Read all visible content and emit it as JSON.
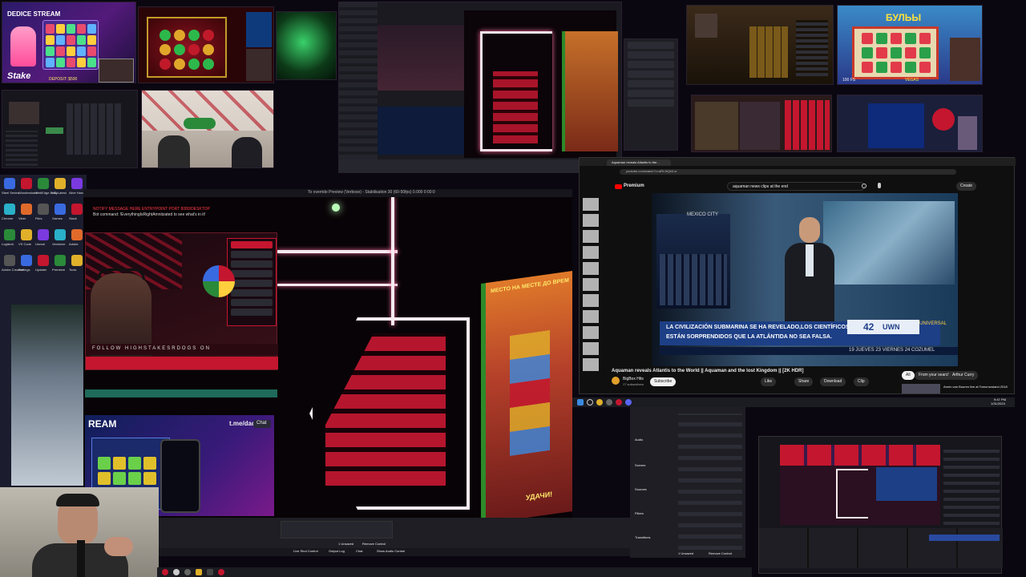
{
  "top_left_stream": {
    "title": "DEDICE STREAM",
    "brand": "Stake",
    "deposit_label": "DEPOSIT: $500"
  },
  "main_window": {
    "title": "To override Preview (Verbose) - Stabilisation 30 (60-50fps) 0.000 0:00:0",
    "chat_lines": [
      "NOTIFY MESSAGE HERE ENTRYPOINT PORT 8080/DESKTOP",
      "Bot command: !EverythingIsRightAmnitzated to see what's in it!"
    ],
    "follow_banner": "FOLLOW HIGHSTAKESRDOGS ON",
    "stream_label": "REAM",
    "telegram_label": "t.me/dad",
    "chat_button": "Chat",
    "slot_banner_top": "МЕСТО НА МЕСТЕ ДО ВРЕМ",
    "slot_banner_bottom": "УДАЧИ!",
    "status_items": [
      "1 Unsaved",
      "Remove Control"
    ],
    "bottom_tabs": [
      "Live Shot Control",
      "Output Log",
      "Chat",
      "Show Audio Control"
    ]
  },
  "obs_side_panel": {
    "section_labels": [
      "Audio",
      "Scenes",
      "Sources",
      "Filters",
      "Transitions"
    ],
    "bottom_items": [
      "1 Unsaved",
      "Remove Control"
    ]
  },
  "youtube": {
    "tab_title": "Aquaman reveals Atlantis to the...",
    "url": "youtube.com/watch?v=aRL5iQb3-w",
    "brand": "Premium",
    "search_query": "aquaman news clips at the end",
    "create_label": "Create",
    "video_title": "Aquaman reveals Atlantis to the World || Aquaman and the lost Kingdom || [2K HDR]",
    "channel": "BigBox Hits",
    "subscribers": "17 subscribers",
    "subscribe": "Subscribe",
    "actions": [
      "Like",
      "Share",
      "Download",
      "Clip"
    ],
    "filter_chips": [
      "All",
      "From your search",
      "Arthur Curry"
    ],
    "up_next": "Armin van Buuren live at Tomorrowland 2018",
    "news": {
      "city_tag": "MEXICO CITY",
      "channel_num": "42",
      "channel_name": "UWN",
      "ticker_tag": "UNIVERSAL",
      "headline_line1": "LA CIVILIZACIÓN SUBMARINA SE HA REVELADO,LOS CIENTÍFICOS",
      "headline_line2": "ESTÁN SORPRENDIDOS QUE LA ATLÁNTIDA NO SEA FALSA.",
      "ticker": "19   JUEVES 23   VIERNES 24   COZUMEL"
    }
  },
  "top_right_streams": {
    "title_bulba": "БУЛЬЫ",
    "balance_label": "100 FS",
    "brand": "VEGAS"
  },
  "desktop_icons": [
    "Steel Series",
    "Wondershare",
    "WebEdge Body",
    "HD Latest",
    "Alive Hand",
    "Chrome",
    "Viber",
    "Files",
    "Games",
    "Slack",
    "Logitech",
    "VS Code",
    "Unreal",
    "Vectorize",
    "Adobe",
    "Adobe Creative",
    "Settings",
    "Updater",
    "Premiere",
    "Tools"
  ],
  "clock": {
    "time": "9:47 PM",
    "date": "1/31/2024"
  },
  "colors": {
    "red": "#c4162e",
    "neon_white": "#f6eaee",
    "yt_bg": "#0f0f0f",
    "obs_bg": "#1e1e24",
    "news_blue": "#1d3f86"
  }
}
